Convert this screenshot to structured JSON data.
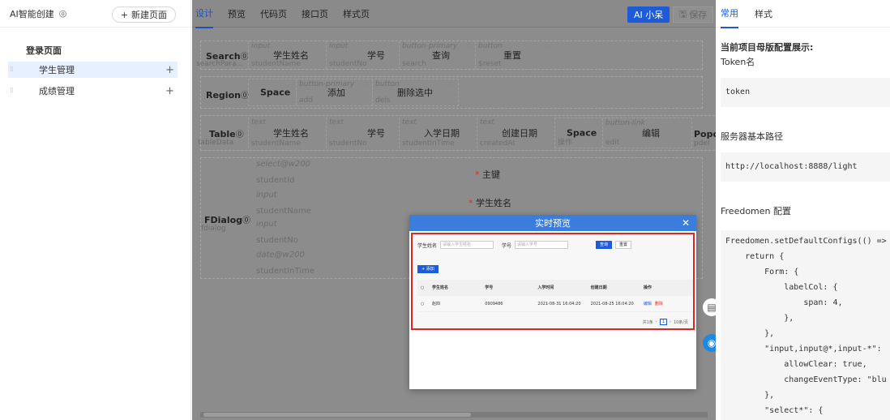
{
  "sidebar": {
    "title": "AI智能创建",
    "new_page": "新建页面",
    "group": "登录页面",
    "items": [
      {
        "label": "学生管理"
      },
      {
        "label": "成绩管理"
      }
    ]
  },
  "toolbar": {
    "tabs": [
      "设计",
      "预览",
      "代码页",
      "接口页",
      "样式页"
    ],
    "ai_label": "AI 小呆",
    "save_label": "保存"
  },
  "canvas": {
    "search": {
      "label": "Search",
      "sub": "searchPara...",
      "cells": [
        {
          "type": "input",
          "text": "学生姓名",
          "key": "studentName"
        },
        {
          "type": "input",
          "text": "学号",
          "key": "studentNo"
        },
        {
          "type": "button-primary",
          "text": "查询",
          "key": "search"
        },
        {
          "type": "button",
          "text": "重置",
          "key": "$reset"
        }
      ]
    },
    "region": {
      "label": "Region",
      "space": "Space",
      "cells": [
        {
          "type": "button-primary",
          "text": "添加",
          "key": "add"
        },
        {
          "type": "button",
          "text": "删除选中",
          "key": "dels"
        }
      ]
    },
    "table": {
      "label": "Table",
      "sub": "tableData",
      "cells": [
        {
          "type": "text",
          "text": "学生姓名",
          "key": "studentName"
        },
        {
          "type": "text",
          "text": "学号",
          "key": "studentNo"
        },
        {
          "type": "text",
          "text": "入学日期",
          "key": "studentInTime"
        },
        {
          "type": "text",
          "text": "创建日期",
          "key": "createdAt"
        }
      ],
      "space": "Space",
      "space_sub": "操作",
      "link_type": "button-link",
      "link_text": "编辑",
      "link_key": "edit",
      "popcon": "Popcon",
      "popcon_sub": "pdel"
    },
    "fdialog": {
      "label": "FDialog",
      "sub": "fdialog",
      "rows": [
        "select@w200",
        "studentId",
        "input",
        "studentName",
        "input",
        "studentNo",
        "date@w200",
        "studentInTime"
      ],
      "field_pk": "主键",
      "field_name": "学生姓名"
    }
  },
  "preview": {
    "title": "实时预览",
    "search_name_label": "学生姓名",
    "search_name_placeholder": "请输入学生姓名",
    "search_no_label": "学号",
    "search_no_placeholder": "请输入学号",
    "query": "查询",
    "reset": "重置",
    "add": "+ 添加",
    "columns": [
      "学生姓名",
      "学号",
      "入学时间",
      "创建日期",
      "操作"
    ],
    "rows": [
      {
        "name": "赵四",
        "no": "0909486",
        "in_time": "2021-08-31 16:04:20",
        "created": "2021-08-25 16:04:20",
        "edit": "编辑",
        "del": "删除"
      }
    ],
    "pager_total": "共1条",
    "pager_page": "1",
    "pager_size": "10条/页"
  },
  "right": {
    "tabs": [
      "常用",
      "样式"
    ],
    "heading": "当前项目母版配置展示:",
    "token_label": "Token名",
    "token_value": "token",
    "base_label": "服务器基本路径",
    "base_value": "http://localhost:8888/light",
    "freedomen_label": "Freedomen 配置",
    "code": [
      "Freedomen.setDefaultConfigs(() =>",
      "    return {",
      "        Form: {",
      "            labelCol: {",
      "                span: 4,",
      "            },",
      "        },",
      "        \"input,input@*,input-*\":",
      "            allowClear: true,",
      "            changeEventType: \"blu",
      "        },",
      "        \"select*\": {"
    ]
  }
}
